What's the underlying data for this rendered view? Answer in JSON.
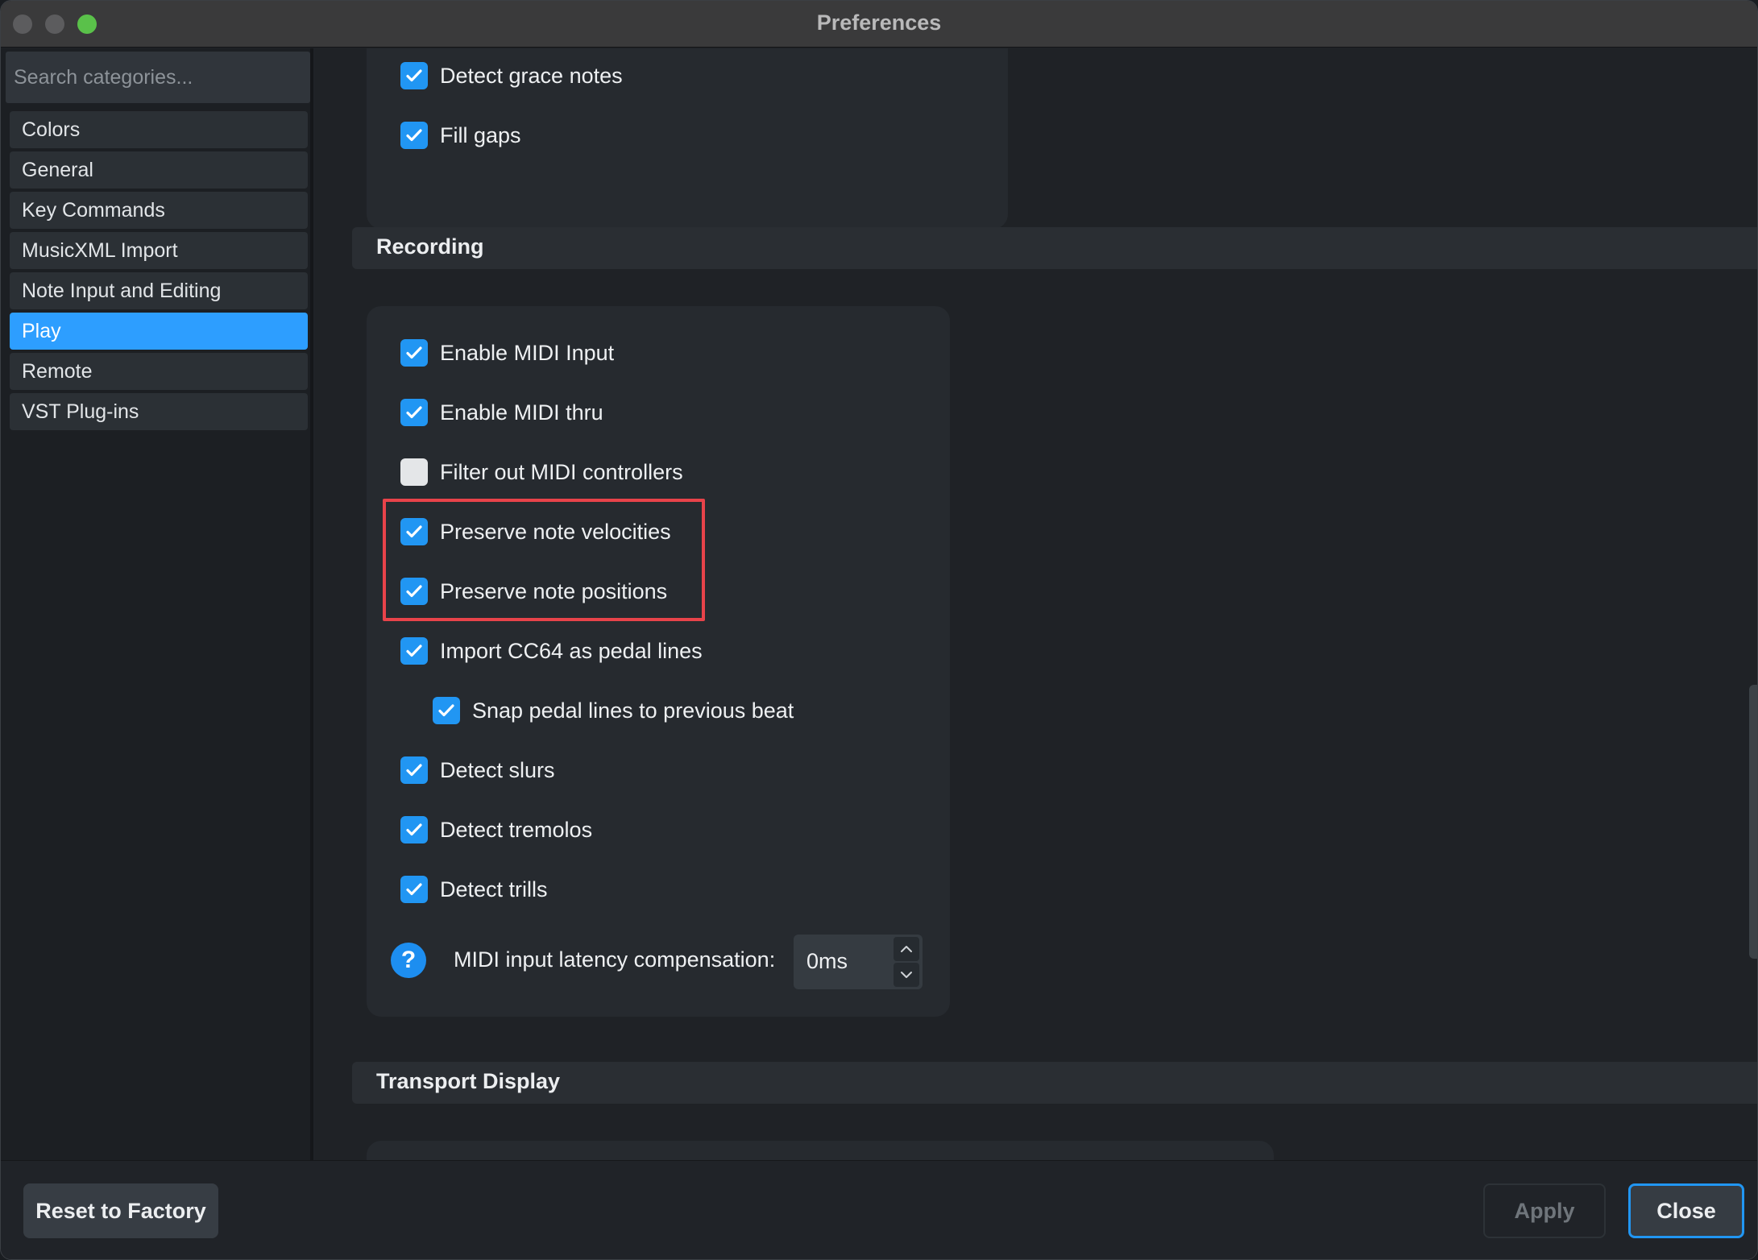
{
  "window": {
    "title": "Preferences"
  },
  "sidebar": {
    "search_placeholder": "Search categories...",
    "items": [
      {
        "label": "Colors",
        "active": false
      },
      {
        "label": "General",
        "active": false
      },
      {
        "label": "Key Commands",
        "active": false
      },
      {
        "label": "MusicXML Import",
        "active": false
      },
      {
        "label": "Note Input and Editing",
        "active": false
      },
      {
        "label": "Play",
        "active": true
      },
      {
        "label": "Remote",
        "active": false
      },
      {
        "label": "VST Plug-ins",
        "active": false
      }
    ]
  },
  "top_panel": {
    "options": [
      {
        "label": "Detect grace notes",
        "checked": true
      },
      {
        "label": "Fill gaps",
        "checked": true
      }
    ]
  },
  "recording": {
    "section_title": "Recording",
    "options": [
      {
        "label": "Enable MIDI Input",
        "checked": true
      },
      {
        "label": "Enable MIDI thru",
        "checked": true
      },
      {
        "label": "Filter out MIDI controllers",
        "checked": false
      },
      {
        "label": "Preserve note velocities",
        "checked": true
      },
      {
        "label": "Preserve note positions",
        "checked": true
      },
      {
        "label": "Import CC64 as pedal lines",
        "checked": true
      },
      {
        "label": "Snap pedal lines to previous beat",
        "checked": true
      },
      {
        "label": "Detect slurs",
        "checked": true
      },
      {
        "label": "Detect tremolos",
        "checked": true
      },
      {
        "label": "Detect trills",
        "checked": true
      }
    ],
    "latency": {
      "help_glyph": "?",
      "label": "MIDI input latency compensation:",
      "value": "0ms"
    }
  },
  "transport": {
    "section_title": "Transport Display"
  },
  "footer": {
    "reset_label": "Reset to Factory",
    "apply_label": "Apply",
    "close_label": "Close"
  },
  "colors": {
    "accent": "#2196f3",
    "highlight_box": "#e8434a"
  }
}
